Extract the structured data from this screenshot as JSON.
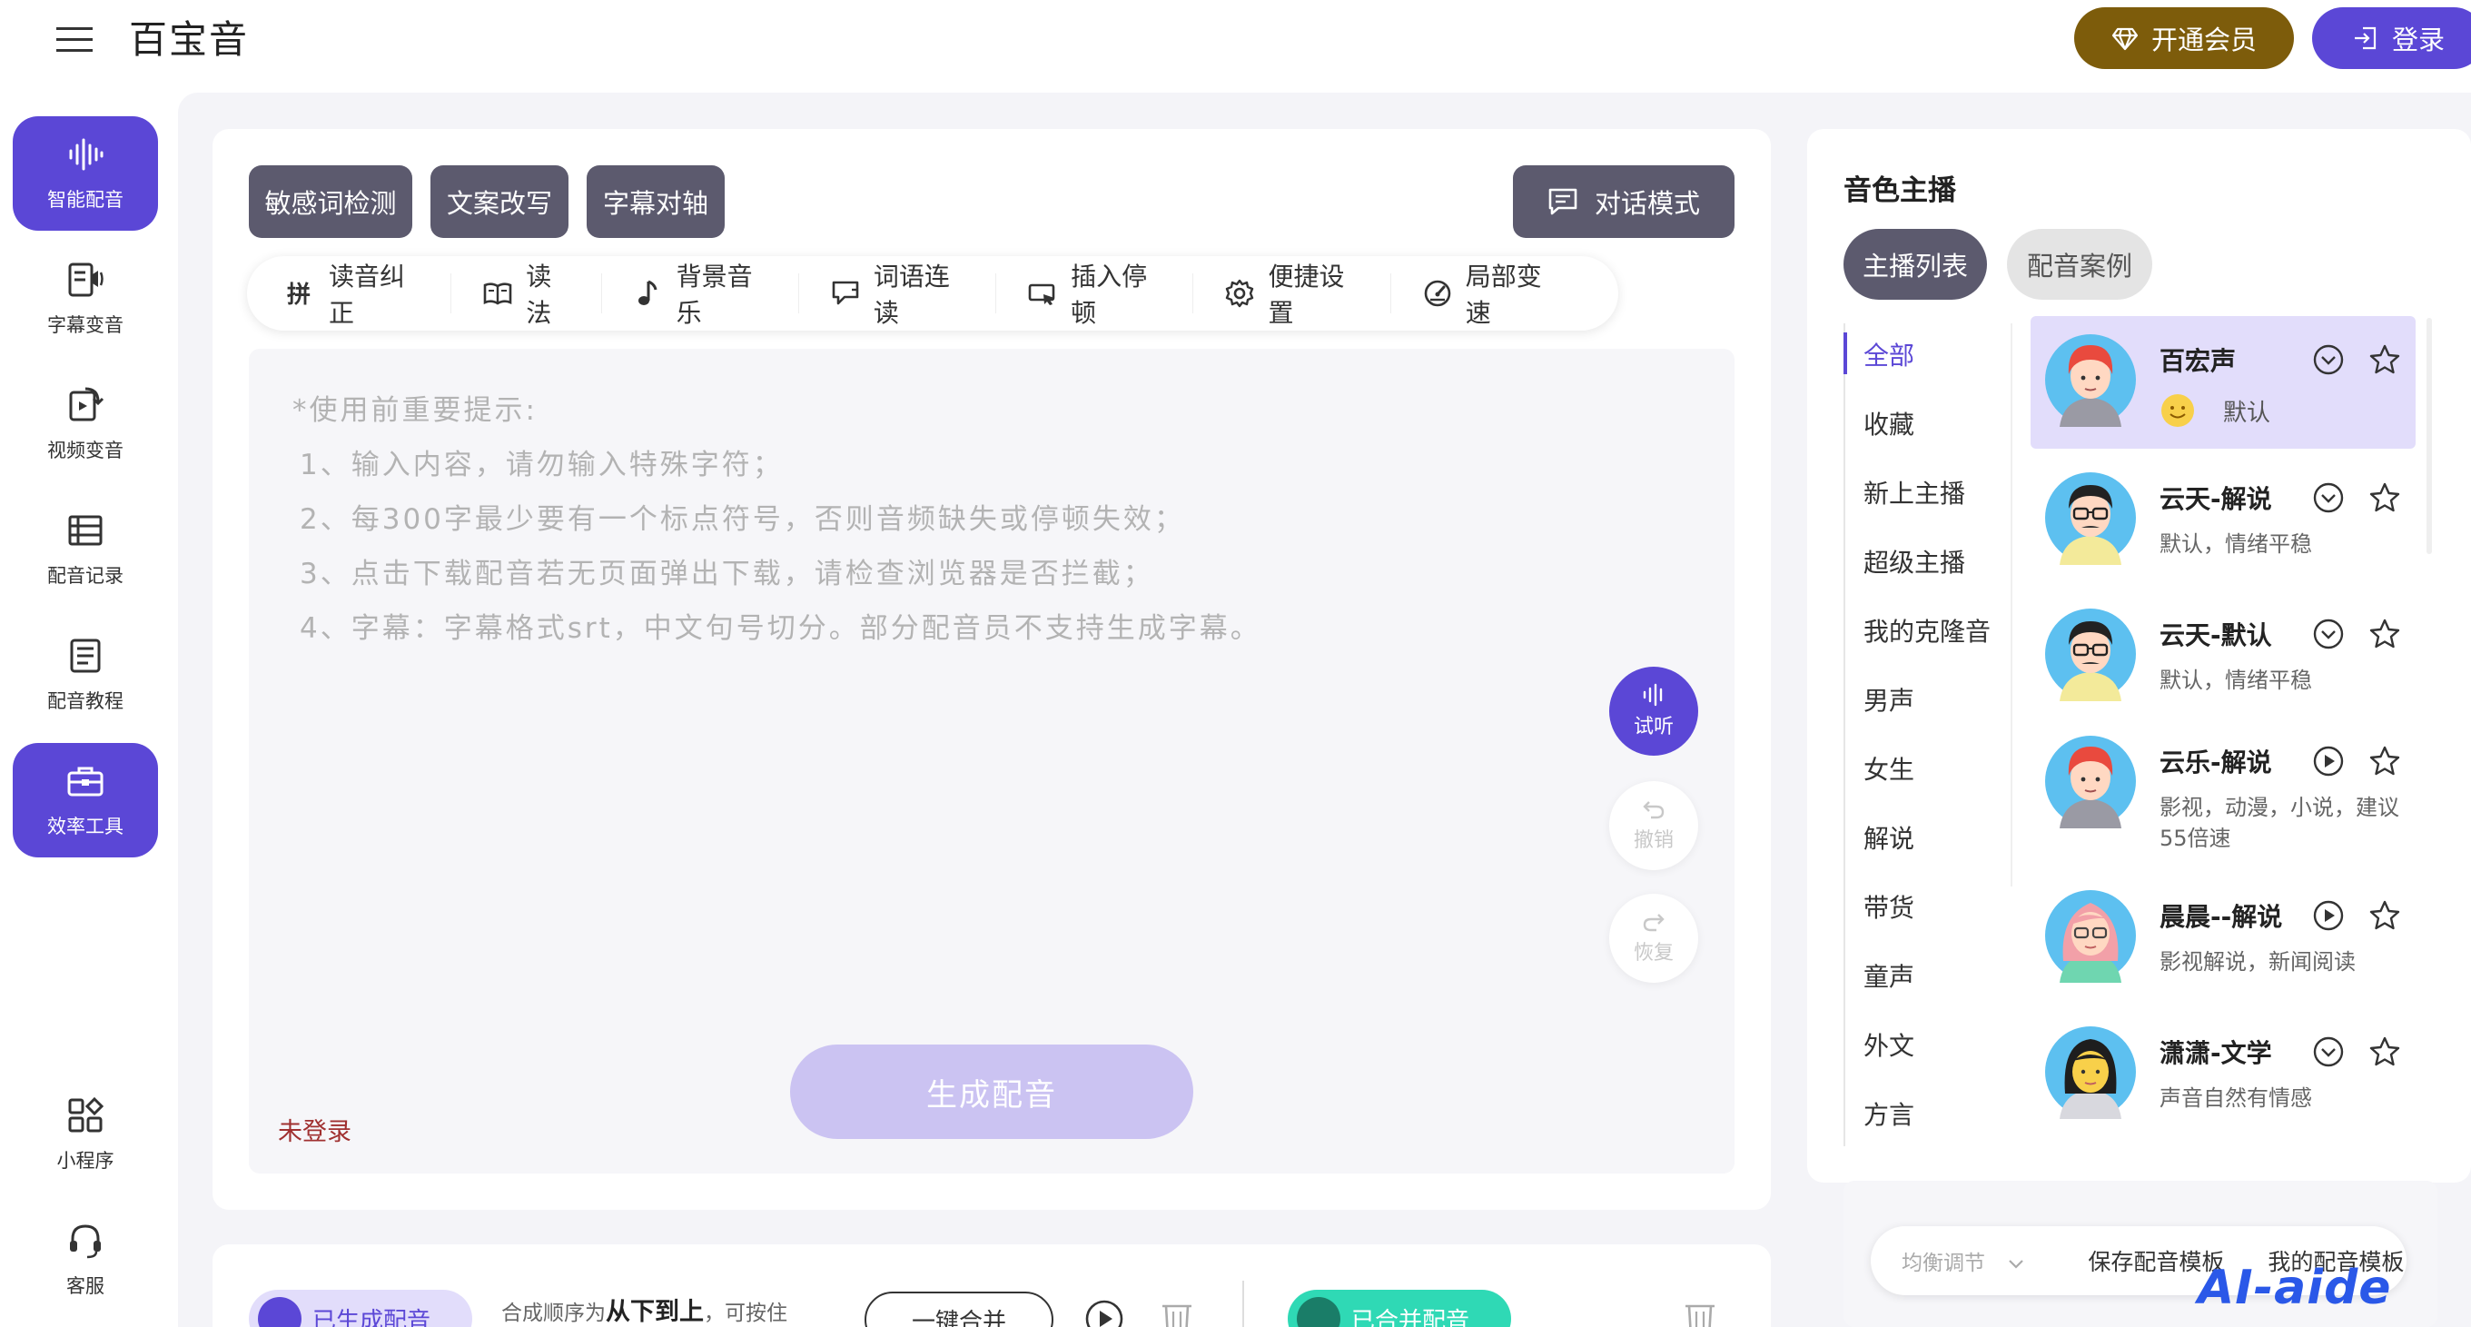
{
  "header": {
    "app_title": "百宝音",
    "vip_label": "开通会员",
    "login_label": "登录"
  },
  "sidebar": {
    "items": [
      {
        "label": "智能配音",
        "icon": "waveform-icon",
        "active": true
      },
      {
        "label": "字幕变音",
        "icon": "subtitle-audio-icon",
        "active": false
      },
      {
        "label": "视频变音",
        "icon": "video-refresh-icon",
        "active": false
      },
      {
        "label": "配音记录",
        "icon": "list-table-icon",
        "active": false
      },
      {
        "label": "配音教程",
        "icon": "document-icon",
        "active": false
      },
      {
        "label": "效率工具",
        "icon": "toolbox-icon",
        "active": true
      }
    ],
    "bottom_items": [
      {
        "label": "小程序",
        "icon": "grid-apps-icon"
      },
      {
        "label": "客服",
        "icon": "headset-icon"
      }
    ]
  },
  "editor": {
    "chips": [
      "敏感词检测",
      "文案改写",
      "字幕对轴"
    ],
    "dialog_mode_label": "对话模式",
    "tools": [
      {
        "label": "读音纠正",
        "icon": "pinyin-icon"
      },
      {
        "label": "读法",
        "icon": "book-icon"
      },
      {
        "label": "背景音乐",
        "icon": "music-note-icon"
      },
      {
        "label": "词语连读",
        "icon": "link-text-icon"
      },
      {
        "label": "插入停顿",
        "icon": "pause-insert-icon"
      },
      {
        "label": "便捷设置",
        "icon": "gear-icon"
      },
      {
        "label": "局部变速",
        "icon": "speedometer-icon"
      }
    ],
    "hints": [
      "*使用前重要提示:",
      "1、输入内容，请勿输入特殊字符；",
      "2、每300字最少要有一个标点符号，否则音频缺失或停顿失效；",
      "3、点击下载配音若无页面弹出下载，请检查浏览器是否拦截；",
      "4、字幕：字幕格式srt，中文句号切分。部分配音员不支持生成字幕。"
    ],
    "preview_label": "试听",
    "undo_label": "撤销",
    "redo_label": "恢复",
    "generate_label": "生成配音",
    "status_text": "未登录"
  },
  "bottom": {
    "generated_label": "已生成配音",
    "order_prefix": "合成顺序为",
    "order_bold": "从下到上",
    "order_suffix": "，可按住",
    "merge_all_label": "一键合并",
    "merged_label": "已合并配音"
  },
  "voice_panel": {
    "title": "音色主播",
    "tabs": [
      "主播列表",
      "配音案例"
    ],
    "categories": [
      "全部",
      "收藏",
      "新上主播",
      "超级主播",
      "我的克隆音",
      "男声",
      "女生",
      "解说",
      "带货",
      "童声",
      "外文",
      "方言"
    ],
    "anchors": [
      {
        "name": "百宏声",
        "desc": "默认",
        "selected": true
      },
      {
        "name": "云天-解说",
        "desc": "默认，情绪平稳"
      },
      {
        "name": "云天-默认",
        "desc": "默认，情绪平稳"
      },
      {
        "name": "云乐-解说",
        "desc": "影视，动漫，小说，建议55倍速"
      },
      {
        "name": "晨晨--解说",
        "desc": "影视解说，新闻阅读"
      },
      {
        "name": "潇潇-文学",
        "desc": "声音自然有情感"
      }
    ],
    "template_bar": {
      "balance_label": "均衡调节",
      "save_label": "保存配音模板",
      "mine_label": "我的配音模板"
    }
  },
  "watermark": "AI-aide",
  "colors": {
    "accent": "#5b47d6",
    "vip": "#7d5c0b",
    "chip": "#5c5a6e",
    "merge": "#2fd9b5"
  }
}
